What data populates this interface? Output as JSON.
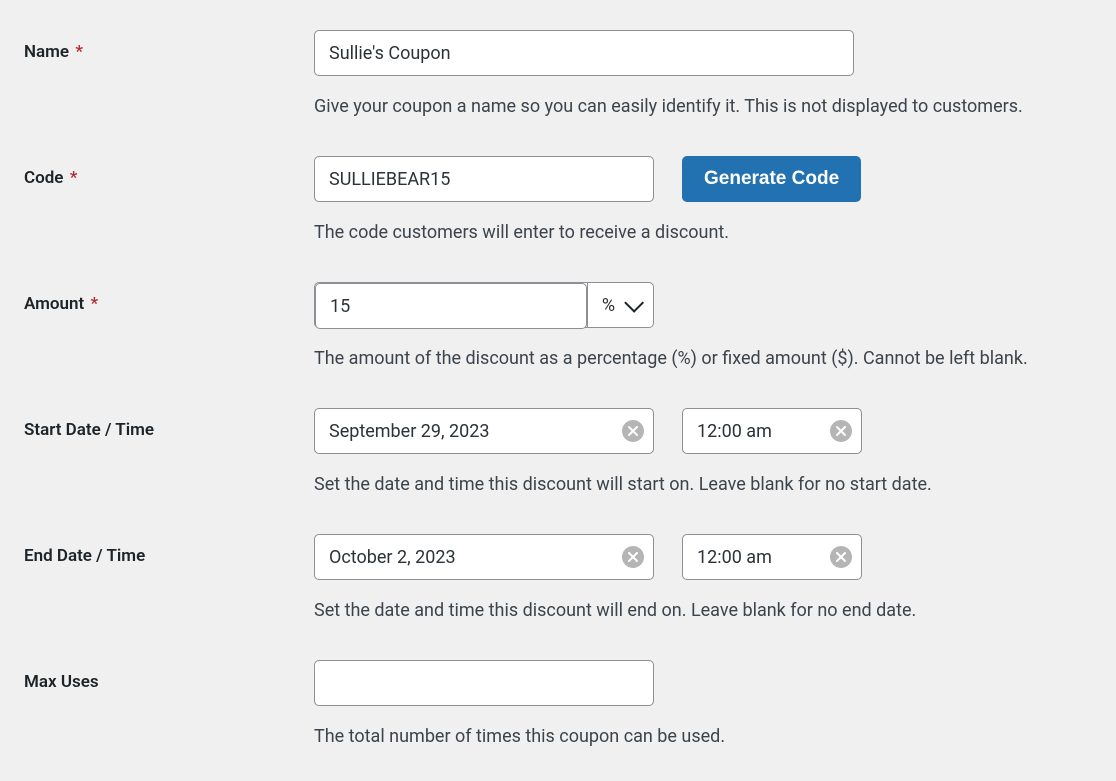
{
  "name": {
    "label": "Name",
    "required": "*",
    "value": "Sullie's Coupon",
    "help": "Give your coupon a name so you can easily identify it. This is not displayed to customers."
  },
  "code": {
    "label": "Code",
    "required": "*",
    "value": "SULLIEBEAR15",
    "help": "The code customers will enter to receive a discount.",
    "button": "Generate Code"
  },
  "amount": {
    "label": "Amount",
    "required": "*",
    "value": "15",
    "type_symbol": "%",
    "help": "The amount of the discount as a percentage (%) or fixed amount ($). Cannot be left blank."
  },
  "start": {
    "label": "Start Date / Time",
    "date": "September 29, 2023",
    "time": "12:00 am",
    "help": "Set the date and time this discount will start on. Leave blank for no start date."
  },
  "end": {
    "label": "End Date / Time",
    "date": "October 2, 2023",
    "time": "12:00 am",
    "help": "Set the date and time this discount will end on. Leave blank for no end date."
  },
  "maxuses": {
    "label": "Max Uses",
    "value": "",
    "help": "The total number of times this coupon can be used."
  }
}
